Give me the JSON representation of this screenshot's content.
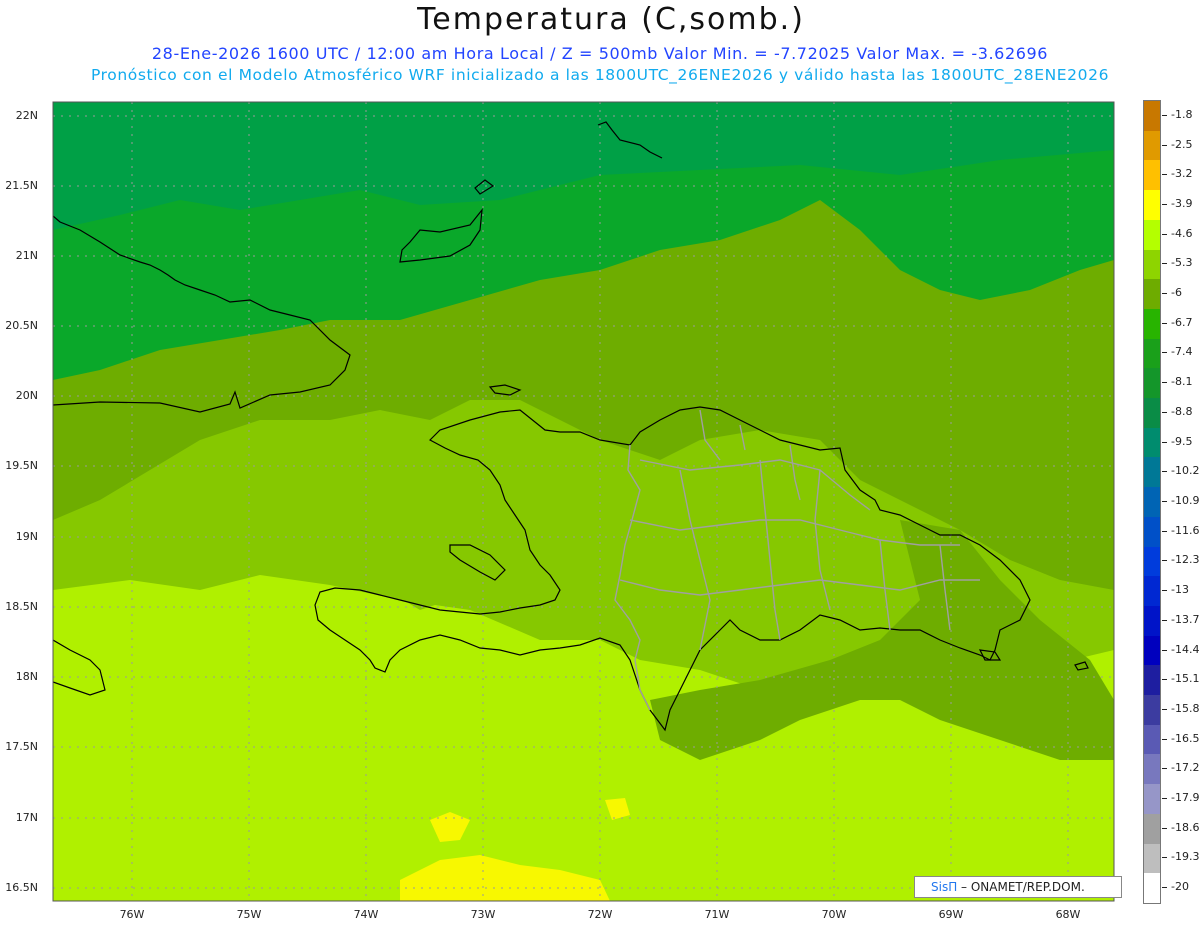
{
  "header": {
    "title": "Temperatura (C,somb.)",
    "line1": "28-Ene-2026  1600 UTC / 12:00 am Hora Local / Z = 500mb  Valor Min. = -7.72025  Valor Max. = -3.62696",
    "line2": "Pronóstico con el Modelo Atmosférico WRF inicializado a las 1800UTC_26ENE2026 y válido hasta las  1800UTC_28ENE2026"
  },
  "axes": {
    "lat_labels": [
      "22N",
      "21.5N",
      "21N",
      "20.5N",
      "20N",
      "19.5N",
      "19N",
      "18.5N",
      "18N",
      "17.5N",
      "17N",
      "16.5N"
    ],
    "lon_labels": [
      "76W",
      "75W",
      "74W",
      "73W",
      "72W",
      "71W",
      "70W",
      "69W",
      "68W"
    ]
  },
  "colorbar": {
    "labels": [
      "-1.8",
      "-2.5",
      "-3.2",
      "-3.9",
      "-4.6",
      "-5.3",
      "-6",
      "-6.7",
      "-7.4",
      "-8.1",
      "-8.8",
      "-9.5",
      "-10.2",
      "-10.9",
      "-11.6",
      "-12.3",
      "-13",
      "-13.7",
      "-14.4",
      "-15.1",
      "-15.8",
      "-16.5",
      "-17.2",
      "-17.9",
      "-18.6",
      "-19.3",
      "-20"
    ],
    "colors": [
      "#c87800",
      "#e09a00",
      "#ffc000",
      "#ffff00",
      "#b4ff00",
      "#8ed400",
      "#6eac00",
      "#28b400",
      "#1aa01a",
      "#14962a",
      "#0a8c46",
      "#008c6e",
      "#007896",
      "#0064b4",
      "#0050c8",
      "#003cdc",
      "#0028d2",
      "#0014c8",
      "#0000be",
      "#1e1ea0",
      "#3c3ca0",
      "#5a5ab4",
      "#7878be",
      "#9696c8",
      "#a0a0a0",
      "#bebebe",
      "#ffffff"
    ]
  },
  "credit": {
    "brand": "SisΠ",
    "text": " – ONAMET/REP.DOM."
  },
  "field_colors": {
    "north": "#0aa82a",
    "mid": "#6ead00",
    "band": "#86c800",
    "south": "#b0f000",
    "yellow": "#f8f800"
  }
}
